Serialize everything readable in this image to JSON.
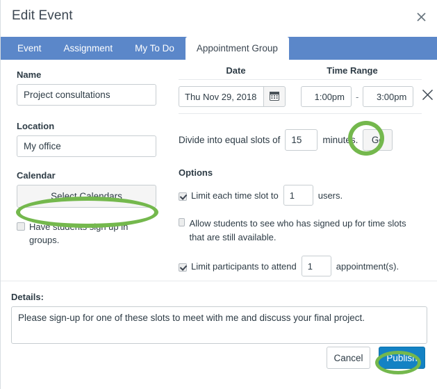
{
  "dialog": {
    "title": "Edit Event",
    "close_icon": "close-icon"
  },
  "tabs": [
    {
      "label": "Event",
      "active": false
    },
    {
      "label": "Assignment",
      "active": false
    },
    {
      "label": "My To Do",
      "active": false
    },
    {
      "label": "Appointment Group",
      "active": true
    }
  ],
  "left": {
    "name_label": "Name",
    "name_value": "Project consultations",
    "location_label": "Location",
    "location_value": "My office",
    "calendar_label": "Calendar",
    "select_calendars_label": "Select Calendars",
    "groups_checkbox_label": "Have students sign up in groups.",
    "groups_checkbox_checked": false
  },
  "schedule": {
    "date_header": "Date",
    "time_header": "Time Range",
    "date_value": "Thu Nov 29, 2018",
    "calendar_icon": "calendar-icon",
    "start_time": "1:00pm",
    "time_separator": "-",
    "end_time": "3:00pm",
    "delete_icon": "close-icon",
    "divide_prefix": "Divide into equal slots of",
    "slot_minutes": "15",
    "divide_suffix": "minutes.",
    "go_label": "Go"
  },
  "options": {
    "title": "Options",
    "limit_slot_prefix": "Limit each time slot to",
    "limit_slot_value": "1",
    "limit_slot_suffix": "users.",
    "limit_slot_checked": true,
    "visibility_label": "Allow students to see who has signed up for time slots that are still available.",
    "visibility_checked": false,
    "limit_participants_prefix": "Limit participants to attend",
    "limit_participants_value": "1",
    "limit_participants_suffix": "appointment(s).",
    "limit_participants_checked": true
  },
  "details": {
    "label": "Details:",
    "value": "Please sign-up for one of these slots to meet with me and discuss your final project."
  },
  "footer": {
    "cancel_label": "Cancel",
    "publish_label": "Publish"
  },
  "annotations": {
    "color": "#74b84d",
    "targets": [
      "Select Calendars",
      "Go",
      "Publish"
    ]
  },
  "colors": {
    "tab_bar_blue": "#5b87c9",
    "publish_blue": "#1482c4",
    "highlight_green": "#74b84d",
    "text": "#2d3b45",
    "border": "#c7cdd1"
  }
}
